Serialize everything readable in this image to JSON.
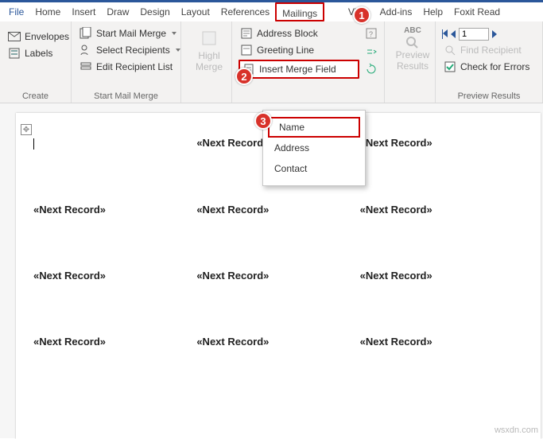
{
  "menubar": {
    "file": "File",
    "home": "Home",
    "insert": "Insert",
    "draw": "Draw",
    "design": "Design",
    "layout": "Layout",
    "references": "References",
    "mailings": "Mailings",
    "w": "w",
    "view": "View",
    "addins": "Add-ins",
    "help": "Help",
    "foxit": "Foxit Read"
  },
  "ribbon": {
    "create": {
      "envelopes": "Envelopes",
      "labels": "Labels",
      "group": "Create"
    },
    "startmm": {
      "start": "Start Mail Merge",
      "select": "Select Recipients",
      "edit": "Edit Recipient List",
      "group": "Start Mail Merge"
    },
    "highlight": {
      "line1": "Highl",
      "line2": "Merge"
    },
    "insertFields": {
      "address": "Address Block",
      "greeting": "Greeting Line",
      "insert": "Insert Merge Field"
    },
    "preview": {
      "line1": "Preview",
      "line2": "Results",
      "abc": "ABC"
    },
    "navresults": {
      "record": "1",
      "find": "Find Recipient",
      "check": "Check for Errors",
      "group": "Preview Results"
    }
  },
  "dropdown": {
    "name": "Name",
    "address": "Address",
    "contact": "Contact"
  },
  "doc": {
    "next": "«Next Record»"
  },
  "callouts": {
    "c1": "1",
    "c2": "2",
    "c3": "3"
  },
  "watermark": "wsxdn.com"
}
